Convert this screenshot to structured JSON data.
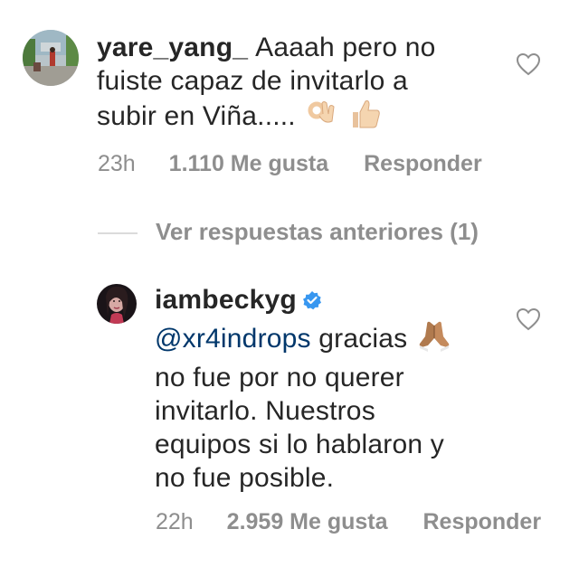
{
  "comments": [
    {
      "username": "yare_yang_",
      "text_line1": "Aaaah pero no",
      "text_line2": "fuiste capaz de invitarlo a",
      "text_line3": "subir en Viña.....",
      "time": "23h",
      "likes": "1.110 Me gusta",
      "reply": "Responder",
      "emojis": [
        "ok-hand-emoji",
        "thumbs-up-emoji"
      ]
    },
    {
      "username": "iambeckyg",
      "verified": true,
      "mention": "@xr4indrops",
      "text_line1_rest": " gracias",
      "text_line2": "no fue por no querer",
      "text_line3": "invitarlo. Nuestros",
      "text_line4": "equipos si lo hablaron y",
      "text_line5": "no fue posible.",
      "time": "22h",
      "likes": "2.959 Me gusta",
      "reply": "Responder",
      "emojis": [
        "folded-hands-emoji"
      ]
    }
  ],
  "view_replies": "Ver respuestas anteriores (1)",
  "colors": {
    "text": "#262626",
    "meta": "#8e8e8e",
    "mention": "#00376b",
    "verified": "#3897f0",
    "divider": "#dbdbdb"
  }
}
